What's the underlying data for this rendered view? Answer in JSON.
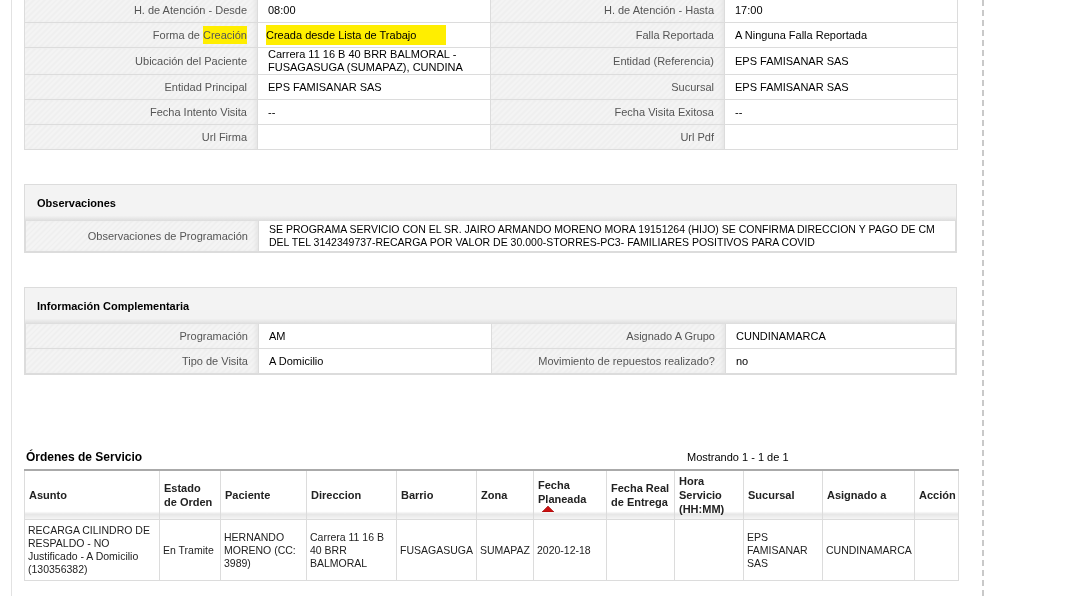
{
  "details": {
    "rows": [
      {
        "left": {
          "label": [
            {
              "text": "H. de Atención - Desde",
              "highlighted": false
            }
          ],
          "value": "08:00",
          "highlighted": false
        },
        "right": {
          "label": "H. de Atención - Hasta",
          "value": "17:00"
        }
      },
      {
        "left": {
          "label": [
            {
              "text": "Forma de ",
              "highlighted": false
            },
            {
              "text": "Creación",
              "highlighted": true
            }
          ],
          "value": "Creada desde Lista de Trabajo",
          "highlighted": true
        },
        "right": {
          "label": "Falla Reportada",
          "value": "A Ninguna Falla Reportada"
        }
      },
      {
        "left": {
          "label": [
            {
              "text": "Ubicación del Paciente",
              "highlighted": false
            }
          ],
          "value": "Carrera 11 16 B 40 BRR BALMORAL - FUSAGASUGA (SUMAPAZ), CUNDINA",
          "highlighted": false
        },
        "right": {
          "label": "Entidad (Referencia)",
          "value": "EPS FAMISANAR SAS"
        }
      },
      {
        "left": {
          "label": [
            {
              "text": "Entidad Principal",
              "highlighted": false
            }
          ],
          "value": "EPS FAMISANAR SAS",
          "highlighted": false
        },
        "right": {
          "label": "Sucursal",
          "value": "EPS FAMISANAR SAS"
        }
      },
      {
        "left": {
          "label": [
            {
              "text": "Fecha Intento Visita",
              "highlighted": false
            }
          ],
          "value": "--",
          "highlighted": false
        },
        "right": {
          "label": "Fecha Visita Exitosa",
          "value": "--"
        }
      },
      {
        "left": {
          "label": [
            {
              "text": "Url Firma",
              "highlighted": false
            }
          ]
        },
        "right": {
          "label": "Url Pdf"
        }
      }
    ]
  },
  "observaciones": {
    "title": "Observaciones",
    "label": "Observaciones de Programación",
    "value": "SE PROGRAMA SERVICIO CON EL SR. JAIRO ARMANDO MORENO MORA 19151264 (HIJO) SE CONFIRMA DIRECCION Y PAGO DE CM DEL TEL 3142349737-RECARGA POR VALOR DE 30.000-STORRES-PC3- FAMILIARES POSITIVOS PARA COVID"
  },
  "complementaria": {
    "title": "Información Complementaria",
    "rows": [
      {
        "left": {
          "label": "Programación",
          "value": "AM"
        },
        "right": {
          "label": "Asignado A Grupo",
          "value": "CUNDINAMARCA"
        }
      },
      {
        "left": {
          "label": "Tipo de Visita",
          "value": "A Domicilio"
        },
        "right": {
          "label": "Movimiento de repuestos realizado?",
          "value": "no"
        }
      }
    ]
  },
  "ordenes": {
    "title": "Órdenes de Servicio",
    "paging": "Mostrando 1 - 1 de 1",
    "columns": [
      {
        "label": "Asunto",
        "sorted": false
      },
      {
        "label": "Estado de Orden",
        "sorted": false
      },
      {
        "label": "Paciente",
        "sorted": false
      },
      {
        "label": "Direccion",
        "sorted": false
      },
      {
        "label": "Barrio",
        "sorted": false
      },
      {
        "label": "Zona",
        "sorted": false
      },
      {
        "label": "Fecha Planeada",
        "sorted": true
      },
      {
        "label": "Fecha Real de Entrega",
        "sorted": false
      },
      {
        "label": "Hora Servicio (HH:MM)",
        "sorted": false
      },
      {
        "label": "Sucursal",
        "sorted": false
      },
      {
        "label": "Asignado a",
        "sorted": false
      },
      {
        "label": "Acción",
        "sorted": false
      }
    ],
    "rows": [
      {
        "cells": [
          "RECARGA CILINDRO DE RESPALDO - NO Justificado - A Domicilio (130356382)",
          "En Tramite",
          "HERNANDO MORENO (CC: 3989)",
          "Carrera 11 16 B 40 BRR BALMORAL",
          "FUSAGASUGA",
          "SUMAPAZ",
          "2020-12-18",
          "",
          "",
          "EPS FAMISANAR SAS",
          "CUNDINAMARCA",
          ""
        ]
      }
    ]
  }
}
